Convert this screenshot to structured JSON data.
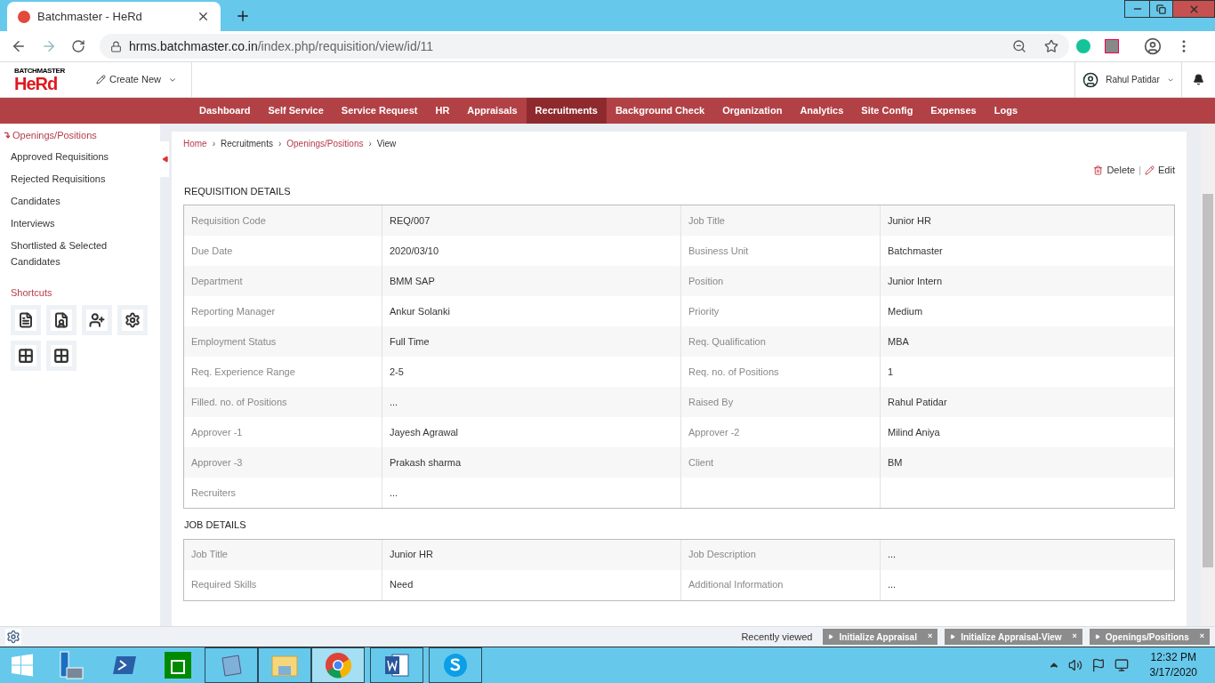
{
  "browser": {
    "tab_title": "Batchmaster - HeRd",
    "url_host": "hrms.batchmaster.co.in",
    "url_path": "/index.php/requisition/view/id/11"
  },
  "app_header": {
    "logo_caption": "BATCHMASTER",
    "logo_text": "HeRd",
    "create_new": "Create New",
    "user_name": "Rahul Patidar"
  },
  "nav": [
    {
      "label": "Dashboard",
      "selected": false
    },
    {
      "label": "Self Service",
      "selected": false
    },
    {
      "label": "Service Request",
      "selected": false
    },
    {
      "label": "HR",
      "selected": false
    },
    {
      "label": "Appraisals",
      "selected": false
    },
    {
      "label": "Recruitments",
      "selected": true
    },
    {
      "label": "Background Check",
      "selected": false
    },
    {
      "label": "Organization",
      "selected": false
    },
    {
      "label": "Analytics",
      "selected": false
    },
    {
      "label": "Site Config",
      "selected": false
    },
    {
      "label": "Expenses",
      "selected": false
    },
    {
      "label": "Logs",
      "selected": false
    }
  ],
  "sidebar": {
    "section_title": "Openings/Positions",
    "items": [
      "Approved Requisitions",
      "Rejected Requisitions",
      "Candidates",
      "Interviews",
      "Shortlisted & Selected Candidates"
    ],
    "shortcuts_title": "Shortcuts"
  },
  "breadcrumb": [
    {
      "label": "Home",
      "link": true
    },
    {
      "separator": "›",
      "label": "Recruitments",
      "link": false
    },
    {
      "separator": "›",
      "label": "Openings/Positions",
      "link": true
    },
    {
      "separator": "›",
      "label": "View",
      "link": false
    }
  ],
  "actions": {
    "delete": "Delete",
    "separator": "|",
    "edit": "Edit"
  },
  "sections": [
    {
      "title": "REQUISITION DETAILS",
      "rows": [
        [
          {
            "label": "Requisition Code",
            "value": "REQ/007"
          },
          {
            "label": "Job Title",
            "value": "Junior HR"
          }
        ],
        [
          {
            "label": "Due Date",
            "value": "2020/03/10"
          },
          {
            "label": "Business Unit",
            "value": "Batchmaster"
          }
        ],
        [
          {
            "label": "Department",
            "value": "BMM SAP"
          },
          {
            "label": "Position",
            "value": "Junior Intern"
          }
        ],
        [
          {
            "label": "Reporting Manager",
            "value": "Ankur Solanki"
          },
          {
            "label": "Priority",
            "value": "Medium"
          }
        ],
        [
          {
            "label": "Employment Status",
            "value": "Full Time"
          },
          {
            "label": "Req. Qualification",
            "value": "MBA"
          }
        ],
        [
          {
            "label": "Req. Experience Range",
            "value": "2-5"
          },
          {
            "label": "Req. no. of Positions",
            "value": "1"
          }
        ],
        [
          {
            "label": "Filled. no. of Positions",
            "value": "..."
          },
          {
            "label": "Raised By",
            "value": "Rahul Patidar"
          }
        ],
        [
          {
            "label": "Approver -1",
            "value": "Jayesh Agrawal"
          },
          {
            "label": "Approver -2",
            "value": "Milind Aniya"
          }
        ],
        [
          {
            "label": "Approver -3",
            "value": "Prakash sharma"
          },
          {
            "label": "Client",
            "value": "BM"
          }
        ],
        [
          {
            "label": "Recruiters",
            "value": "..."
          }
        ]
      ]
    },
    {
      "title": "JOB DETAILS",
      "rows": [
        [
          {
            "label": "Job Title",
            "value": "Junior HR"
          },
          {
            "label": "Job Description",
            "value": "..."
          }
        ],
        [
          {
            "label": "Required Skills",
            "value": "Need"
          },
          {
            "label": "Additional Information",
            "value": "..."
          }
        ]
      ]
    }
  ],
  "recently_viewed": {
    "label": "Recently viewed",
    "items": [
      "Initialize Appraisal",
      "Initialize Appraisal-View",
      "Openings/Positions"
    ],
    "close": "×"
  },
  "taskbar": {
    "time": "12:32 PM",
    "date": "3/17/2020"
  }
}
